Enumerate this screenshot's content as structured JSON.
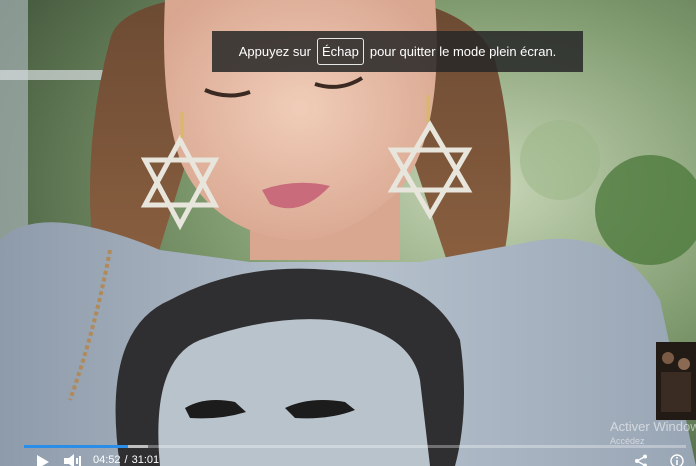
{
  "fullscreen_notice": {
    "prefix": "Appuyez sur",
    "key": "Échap",
    "suffix": "pour quitter le mode plein écran."
  },
  "watermark": {
    "line1": "Activer Windows",
    "line2": "Accédez"
  },
  "player": {
    "current_time": "04:52",
    "separator": "/",
    "duration": "31:01",
    "progress": 0.157,
    "accent_color": "#2a8ee8",
    "icons": [
      "play-icon",
      "volume-icon",
      "share-icon",
      "info-icon"
    ]
  }
}
